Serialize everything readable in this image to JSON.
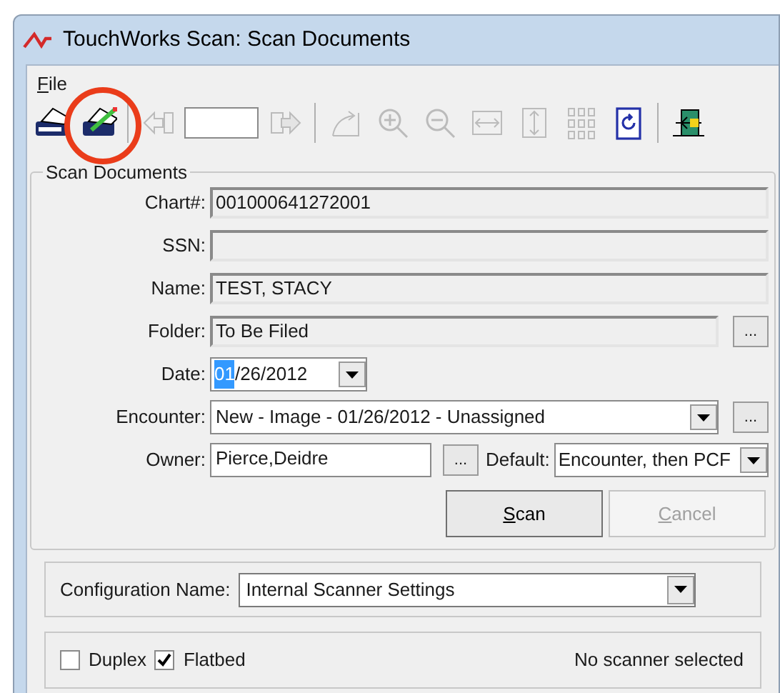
{
  "window": {
    "title": "TouchWorks Scan: Scan Documents"
  },
  "menu": [
    {
      "label": "File"
    }
  ],
  "toolbar": [
    {
      "kind": "scanner",
      "disabled": false
    },
    {
      "kind": "scanner_settings",
      "disabled": false
    },
    {
      "kind": "separator"
    },
    {
      "kind": "prev",
      "disabled": true
    },
    {
      "kind": "page_box"
    },
    {
      "kind": "next",
      "disabled": true
    },
    {
      "kind": "separator"
    },
    {
      "kind": "rotate",
      "disabled": true
    },
    {
      "kind": "zoom_in",
      "disabled": true
    },
    {
      "kind": "zoom_out",
      "disabled": true
    },
    {
      "kind": "fit_width",
      "disabled": true
    },
    {
      "kind": "fit_height",
      "disabled": true
    },
    {
      "kind": "thumbnails",
      "disabled": true
    },
    {
      "kind": "refresh",
      "disabled": false
    },
    {
      "kind": "separator"
    },
    {
      "kind": "exit",
      "disabled": false
    }
  ],
  "group": {
    "title": "Scan Documents",
    "fields": [
      {
        "kind": "readonly",
        "label": "Chart#:",
        "value": "001000641272001"
      },
      {
        "kind": "readonly",
        "label": "SSN:"
      },
      {
        "kind": "readonly",
        "label": "Name:",
        "value": "TEST, STACY"
      },
      {
        "kind": "readonly",
        "label": "Folder:",
        "value": "To Be Filed",
        "browse": true,
        "browse_label": "..."
      },
      {
        "kind": "date",
        "label": "Date:",
        "highlighted": "01",
        "value": "/26/2012"
      },
      {
        "kind": "combo",
        "label": "Encounter:",
        "value": "New - Image - 01/26/2012 - Unassigned",
        "browse": true,
        "browse_label": "..."
      },
      {
        "kind": "owner",
        "label": "Owner:",
        "value": "Pierce,Deidre",
        "browse": true,
        "browse_label": "...",
        "default_label": "Default:",
        "default_value": "Encounter, then PCF"
      }
    ],
    "buttons": [
      {
        "label": "Scan",
        "disabled": false
      },
      {
        "label": "Cancel",
        "disabled": true
      }
    ],
    "configuration": {
      "label": "Configuration Name:",
      "value": "Internal Scanner Settings"
    },
    "options": [
      {
        "label": "Duplex",
        "checked": false
      },
      {
        "label": "Flatbed",
        "checked": true
      }
    ],
    "status": "No scanner selected"
  },
  "annotations": [
    {
      "kind": "circle"
    }
  ]
}
